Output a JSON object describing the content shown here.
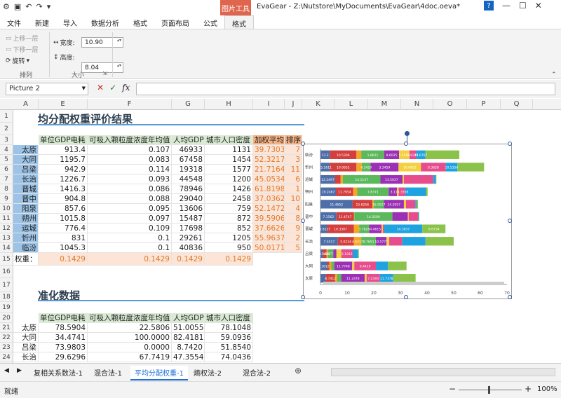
{
  "qat": {
    "icons": [
      "app-icon",
      "save-icon",
      "undo-icon",
      "redo-icon",
      "customize-icon"
    ]
  },
  "title": {
    "context_tab": "图片工具",
    "document": "EvaGear - Z:\\Nutstore\\MyDocuments\\EvaGear\\4doc.oeva*",
    "help": "?"
  },
  "tabs": [
    "文件",
    "新建",
    "导入",
    "数据分析",
    "格式",
    "页面布局",
    "公式",
    "格式"
  ],
  "ribbon": {
    "bring_forward": "上移一层",
    "send_backward": "下移一层",
    "rotate": "旋转",
    "group_arrange": "排列",
    "width_label": "宽度:",
    "width_value": "10.90",
    "height_label": "高度:",
    "height_value": "8.04",
    "group_size": "大小"
  },
  "formula_bar": {
    "name_box": "Picture 2",
    "fx": "fx"
  },
  "columns": [
    "A",
    "E",
    "F",
    "G",
    "H",
    "I",
    "J",
    "K",
    "L",
    "M",
    "N",
    "O",
    "P",
    "Q"
  ],
  "rows": [
    "1",
    "2",
    "3",
    "4",
    "5",
    "6",
    "7",
    "8",
    "9",
    "10",
    "11",
    "12",
    "13",
    "14",
    "15",
    "16",
    "17",
    "18",
    "19",
    "20",
    "21",
    "22",
    "23",
    "24",
    "25"
  ],
  "sheet": {
    "title1": "均分配权重评价结果",
    "headers1": [
      "单位GDP电耗",
      "可吸入颗粒度浓度年均值",
      "人均GDP",
      "城市人口密度",
      "加权平均",
      "排序"
    ],
    "table1": [
      [
        "太原",
        "913.4",
        "0.107",
        "46933",
        "1131",
        "39.7303",
        "7"
      ],
      [
        "大同",
        "1195.7",
        "0.083",
        "67458",
        "1454",
        "52.3217",
        "3"
      ],
      [
        "吕梁",
        "942.9",
        "0.114",
        "19318",
        "1577",
        "21.7164",
        "11"
      ],
      [
        "长治",
        "1226.7",
        "0.093",
        "44548",
        "1200",
        "45.0534",
        "6"
      ],
      [
        "晋城",
        "1416.3",
        "0.086",
        "78946",
        "1426",
        "61.8198",
        "1"
      ],
      [
        "晋中",
        "904.8",
        "0.088",
        "29040",
        "2458",
        "37.0362",
        "10"
      ],
      [
        "阳泉",
        "857.6",
        "0.095",
        "13606",
        "759",
        "52.1472",
        "4"
      ],
      [
        "朔州",
        "1015.8",
        "0.097",
        "15487",
        "872",
        "39.5906",
        "8"
      ],
      [
        "运城",
        "776.4",
        "0.109",
        "17698",
        "852",
        "37.6626",
        "9"
      ],
      [
        "忻州",
        "831",
        "0.1",
        "29261",
        "1205",
        "55.9637",
        "2"
      ],
      [
        "临汾",
        "1045.3",
        "0.1",
        "40836",
        "950",
        "50.0171",
        "5"
      ]
    ],
    "weights_label": "权重：",
    "weights": [
      "0.1429",
      "0.1429",
      "0.1429",
      "0.1429"
    ],
    "title2": "准化数据",
    "headers2": [
      "单位GDP电耗",
      "可吸入颗粒度浓度年均值",
      "人均GDP",
      "城市人口密度"
    ],
    "table2": [
      [
        "太原",
        "78.5904",
        "22.5806",
        "51.0055",
        "78.1048"
      ],
      [
        "大同",
        "34.4741",
        "100.0000",
        "82.4181",
        "59.0936"
      ],
      [
        "吕梁",
        "73.9803",
        "0.0000",
        "8.7420",
        "51.8540"
      ],
      [
        "长治",
        "29.6296",
        "67.7419",
        "47.3554",
        "74.0436"
      ]
    ]
  },
  "colors": {
    "accent": "#1e6fd9",
    "header_green": "#d9ead3",
    "header_orange": "#f4b183",
    "city_blue": "#9dc3e6",
    "weight_orange": "#e07b2e",
    "context_tab": "#e0654e"
  },
  "chart_data": {
    "type": "bar",
    "orientation": "horizontal",
    "stacked": true,
    "categories": [
      "临汾",
      "忻州",
      "运城",
      "朔州",
      "阳泉",
      "晋中",
      "晋城",
      "长治",
      "吕梁",
      "大同",
      "太原"
    ],
    "series": [
      {
        "color": "#4e6ea8",
        "values": [
          3.5,
          3.5,
          5.5,
          5.8,
          12.0,
          6.0,
          2.5,
          6.5,
          0.8,
          2.5,
          2.0
        ]
      },
      {
        "color": "#d33f3f",
        "values": [
          10.0,
          10.0,
          2.0,
          6.5,
          7.5,
          6.5,
          10.0,
          6.0,
          1.5,
          0.8,
          3.5
        ]
      },
      {
        "color": "#f5a623",
        "values": [
          1.8,
          2.0,
          0.9,
          1.5,
          0.5,
          0.2,
          2.0,
          2.8,
          0.5,
          0.8,
          0.8
        ]
      },
      {
        "color": "#5cb85c",
        "values": [
          8.6,
          3.3,
          14.1,
          11.8,
          3.8,
          14.3,
          3.8,
          5.5,
          2.0,
          1.1,
          1.5
        ]
      },
      {
        "color": "#9b30b5",
        "values": [
          5.6,
          10.5,
          8.3,
          3.1,
          7.5,
          5.8,
          4.6,
          4.0,
          1.2,
          6.7,
          8.8
        ]
      },
      {
        "color": "#f4d03f",
        "values": [
          3.9,
          8.4,
          0.5,
          0.6,
          0.8,
          0.3,
          0.5,
          1.0,
          1.8,
          0.8,
          0.7
        ]
      },
      {
        "color": "#e74c8c",
        "values": [
          2.5,
          9.3,
          11.0,
          2.5,
          3.5,
          3.5,
          0.5,
          4.8,
          4.3,
          8.1,
          5.0
        ]
      },
      {
        "color": "#1fa2e0",
        "values": [
          3.5,
          4.4,
          1.0,
          7.8,
          0.5,
          0.3,
          14.3,
          8.8,
          2.0,
          4.5,
          5.0
        ]
      },
      {
        "color": "#8bc34a",
        "values": [
          12.7,
          10.0,
          0.2,
          0.6,
          0.5,
          0.2,
          8.7,
          10.6,
          0.3,
          7.0,
          8.4
        ]
      }
    ],
    "xlim": [
      0,
      70
    ],
    "xticks": [
      "0",
      "10",
      "20",
      "30",
      "40",
      "50",
      "60",
      "70"
    ],
    "bar_labels": [
      [
        "13.2",
        "10.5306",
        "1.8621",
        "8.6025",
        "5.5503",
        "3.9325",
        "12.6767"
      ],
      [
        "15.2611",
        "10.0652",
        "4.3429",
        "3.3459",
        "10.6003",
        "8.3628",
        "10.5356"
      ],
      [
        "12.2497",
        "14.1137",
        "13.5037"
      ],
      [
        "19.2467",
        "11.7954",
        "7.8371",
        "3.1",
        "13.3356"
      ],
      [
        "11.4652",
        "15.6256",
        "16.0527",
        "14.2057"
      ],
      [
        "7.1562",
        "11.4747",
        "14.3209"
      ],
      [
        "14.6227",
        "10.3307",
        "3.7826",
        "4.4615",
        "14.3037",
        "8.6734"
      ],
      [
        "7.3517",
        "5.0234",
        "4.6317",
        "8.7651",
        "10.5777"
      ],
      [
        "2.1812",
        "9.2633",
        "7.4077"
      ],
      [
        "6.1612",
        "11.7748",
        "6.4419"
      ],
      [
        "8.7412",
        "11.2478",
        "7.2393",
        "11.7378"
      ]
    ]
  },
  "sheet_tabs": [
    "复相关系数法-1",
    "混合法-1",
    "平均分配权重-1",
    "熵权法-2",
    "混合法-2"
  ],
  "status": {
    "ready": "就绪",
    "zoom": "100%"
  }
}
